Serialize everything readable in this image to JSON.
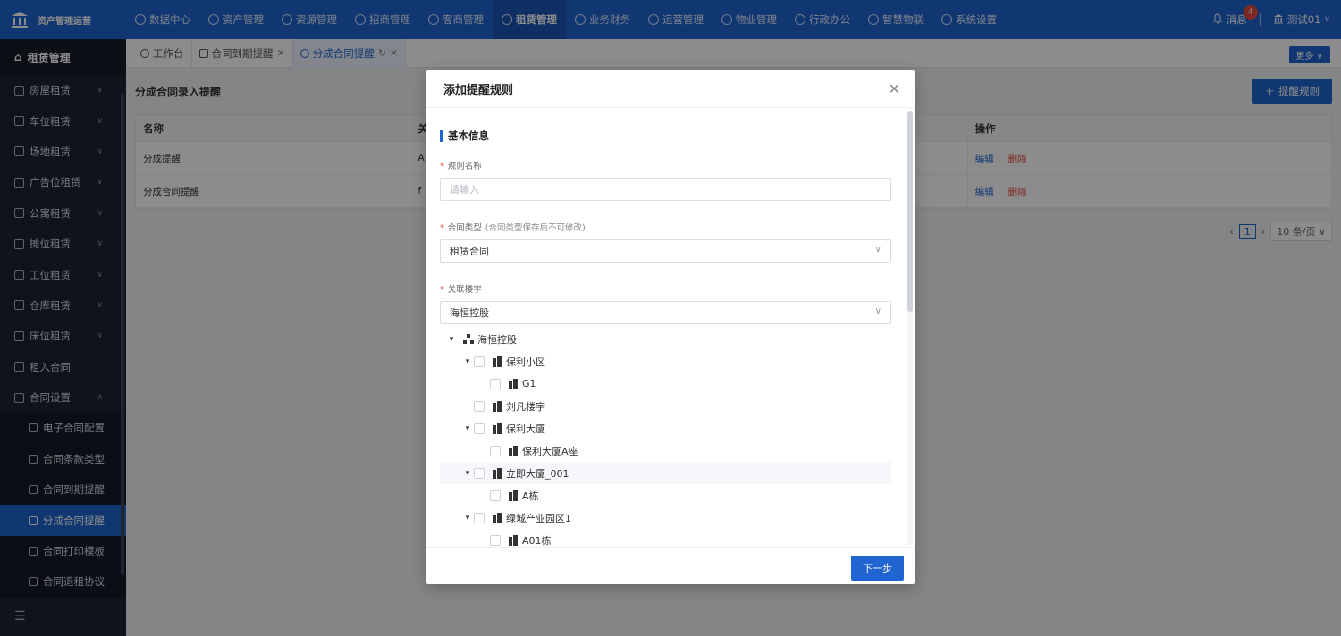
{
  "header": {
    "brand": "资产管理运营",
    "nav": [
      {
        "label": "数据中心",
        "icon": "dashboard-icon"
      },
      {
        "label": "资产管理",
        "icon": "cube-icon"
      },
      {
        "label": "资源管理",
        "icon": "building-icon"
      },
      {
        "label": "招商管理",
        "icon": "tag-icon"
      },
      {
        "label": "客商管理",
        "icon": "users-icon"
      },
      {
        "label": "租赁管理",
        "icon": "home-icon",
        "active": true
      },
      {
        "label": "业务财务",
        "icon": "money-icon"
      },
      {
        "label": "运营管理",
        "icon": "chart-icon"
      },
      {
        "label": "物业管理",
        "icon": "service-icon"
      },
      {
        "label": "行政办公",
        "icon": "monitor-icon"
      },
      {
        "label": "智慧物联",
        "icon": "iot-icon"
      },
      {
        "label": "系统设置",
        "icon": "gear-icon"
      }
    ],
    "messages_label": "消息",
    "messages_count": "4",
    "user_name": "测试01"
  },
  "sidebar": {
    "title": "租赁管理",
    "items": [
      {
        "label": "房屋租赁",
        "icon": "house-icon",
        "expandable": true
      },
      {
        "label": "车位租赁",
        "icon": "parking-icon",
        "expandable": true
      },
      {
        "label": "场地租赁",
        "icon": "venue-icon",
        "expandable": true
      },
      {
        "label": "广告位租赁",
        "icon": "ad-icon",
        "expandable": true
      },
      {
        "label": "公寓租赁",
        "icon": "apartment-icon",
        "expandable": true
      },
      {
        "label": "摊位租赁",
        "icon": "stall-icon",
        "expandable": true
      },
      {
        "label": "工位租赁",
        "icon": "workstation-icon",
        "expandable": true
      },
      {
        "label": "仓库租赁",
        "icon": "warehouse-icon",
        "expandable": true
      },
      {
        "label": "床位租赁",
        "icon": "bed-icon",
        "expandable": true
      },
      {
        "label": "租入合同",
        "icon": "contract-icon",
        "expandable": false
      },
      {
        "label": "合同设置",
        "icon": "settings-icon",
        "expandable": true,
        "expanded": true
      }
    ],
    "subitems": [
      {
        "label": "电子合同配置"
      },
      {
        "label": "合同条款类型"
      },
      {
        "label": "合同到期提醒"
      },
      {
        "label": "分成合同提醒",
        "active": true
      },
      {
        "label": "合同打印模板"
      },
      {
        "label": "合同退租协议"
      }
    ]
  },
  "tabs": [
    {
      "label": "工作台"
    },
    {
      "label": "合同到期提醒"
    },
    {
      "label": "分成合同提醒",
      "active": true
    }
  ],
  "more_label": "更多",
  "page": {
    "title": "分成合同录入提醒",
    "add_button": "提醒规则",
    "columns": [
      "名称",
      "关",
      "操作"
    ],
    "rows": [
      {
        "name": "分成提醒",
        "mid": "A",
        "edit": "编辑",
        "delete": "删除"
      },
      {
        "name": "分成合同提醒",
        "mid": "f",
        "edit": "编辑",
        "delete": "删除"
      }
    ],
    "pager": {
      "current": "1",
      "page_size": "10 条/页"
    }
  },
  "modal": {
    "title": "添加提醒规则",
    "section": "基本信息",
    "fields": {
      "rule_name_label": "规则名称",
      "rule_name_placeholder": "请输入",
      "contract_type_label": "合同类型",
      "contract_type_hint": "(合同类型保存后不可修改)",
      "contract_type_value": "租赁合同",
      "building_label": "关联楼宇",
      "building_value": "海恒控股"
    },
    "tree": [
      {
        "label": "海恒控股",
        "level": 0,
        "caret": true,
        "checkbox": false,
        "icon": "org-icon"
      },
      {
        "label": "保利小区",
        "level": 1,
        "caret": true,
        "checkbox": true,
        "icon": "building-icon"
      },
      {
        "label": "G1",
        "level": 2,
        "caret": false,
        "checkbox": true,
        "icon": "building-icon"
      },
      {
        "label": "刘凡楼宇",
        "level": 1,
        "caret": false,
        "checkbox": true,
        "icon": "building-icon"
      },
      {
        "label": "保利大厦",
        "level": 1,
        "caret": true,
        "checkbox": true,
        "icon": "building-icon"
      },
      {
        "label": "保利大厦A座",
        "level": 2,
        "caret": false,
        "checkbox": true,
        "icon": "building-icon"
      },
      {
        "label": "立即大厦_001",
        "level": 1,
        "caret": true,
        "checkbox": true,
        "icon": "building-icon",
        "highlight": true
      },
      {
        "label": "A栋",
        "level": 2,
        "caret": false,
        "checkbox": true,
        "icon": "building-icon"
      },
      {
        "label": "绿城产业园区1",
        "level": 1,
        "caret": true,
        "checkbox": true,
        "icon": "building-icon"
      },
      {
        "label": "A01栋",
        "level": 2,
        "caret": false,
        "checkbox": true,
        "icon": "building-icon"
      }
    ],
    "next_button": "下一步"
  },
  "colors": {
    "primary": "#1f64d1",
    "sidebar": "#1d2433",
    "danger": "#e84a3d"
  }
}
